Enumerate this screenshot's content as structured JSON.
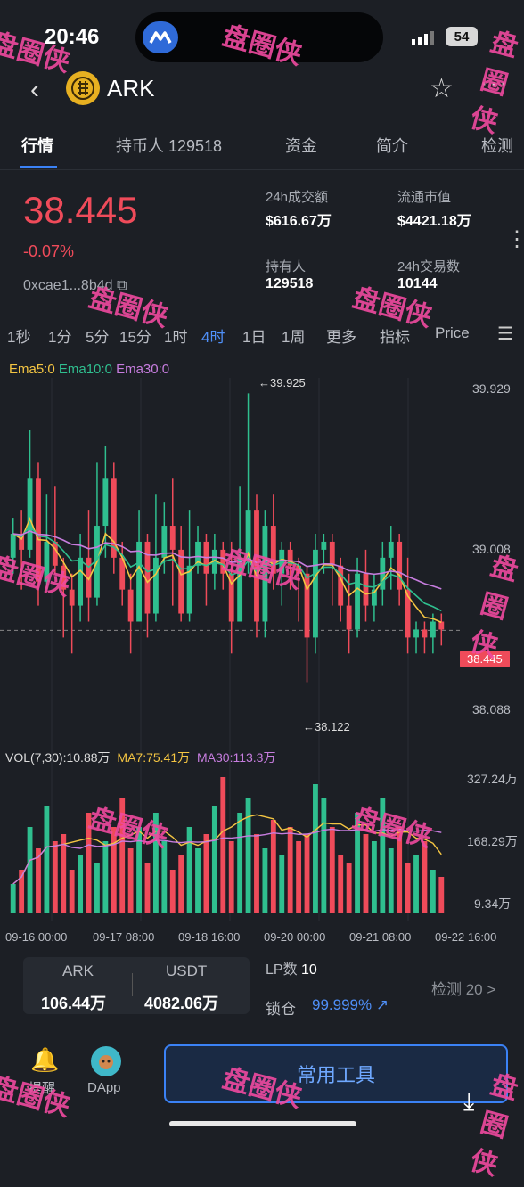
{
  "status_bar": {
    "time": "20:46",
    "battery": "54"
  },
  "header": {
    "back_icon": "back-icon",
    "coin_name": "ARK",
    "star_icon": "star-icon",
    "more_icon": "more-icon"
  },
  "tabs": [
    {
      "label": "行情",
      "active": true
    },
    {
      "label": "持币人 129518"
    },
    {
      "label": "资金"
    },
    {
      "label": "简介"
    },
    {
      "label": "检测"
    }
  ],
  "summary": {
    "price": "38.445",
    "change": "-0.07%",
    "address": "0xcae1...8b4d",
    "stats": [
      {
        "label": "24h成交额",
        "value": "$616.67万"
      },
      {
        "label": "流通市值",
        "value": "$4421.18万"
      },
      {
        "label": "持有人",
        "value": "129518"
      },
      {
        "label": "24h交易数",
        "value": "10144"
      }
    ]
  },
  "intervals": [
    "1秒",
    "1分",
    "5分",
    "15分",
    "1时",
    "4时",
    "1日",
    "1周",
    "更多",
    "指标",
    "Price"
  ],
  "active_interval": "4时",
  "indicators": {
    "ema5": "Ema5:0",
    "ema10": "Ema10:0",
    "ema30": "Ema30:0"
  },
  "chart_data": {
    "type": "candlestick",
    "price_axis": [
      "39.929",
      "39.008",
      "38.088"
    ],
    "current_price_tag": "38.445",
    "high_marker": "←39.925",
    "low_marker": "←38.122",
    "candles": [
      [
        38.9,
        39.05,
        39.15,
        38.8
      ],
      [
        39.05,
        38.95,
        39.2,
        38.7
      ],
      [
        38.95,
        39.4,
        39.7,
        38.9
      ],
      [
        39.4,
        38.75,
        39.5,
        38.6
      ],
      [
        38.75,
        39.0,
        39.3,
        38.7
      ],
      [
        39.0,
        38.85,
        39.35,
        38.8
      ],
      [
        38.85,
        38.7,
        38.9,
        38.4
      ],
      [
        38.7,
        38.6,
        38.8,
        38.3
      ],
      [
        38.6,
        38.9,
        39.05,
        38.5
      ],
      [
        38.9,
        38.65,
        39.2,
        38.5
      ],
      [
        38.65,
        39.1,
        39.5,
        38.6
      ],
      [
        39.1,
        39.4,
        39.6,
        38.9
      ],
      [
        39.4,
        38.9,
        39.5,
        38.8
      ],
      [
        38.9,
        38.7,
        39.0,
        38.6
      ],
      [
        38.7,
        38.5,
        38.8,
        38.3
      ],
      [
        38.5,
        39.0,
        39.2,
        38.5
      ],
      [
        39.0,
        38.55,
        39.05,
        38.4
      ],
      [
        38.55,
        38.9,
        39.3,
        38.5
      ],
      [
        38.9,
        39.1,
        39.25,
        38.8
      ],
      [
        39.1,
        38.95,
        39.4,
        38.6
      ],
      [
        38.95,
        38.55,
        39.1,
        38.5
      ],
      [
        38.55,
        38.85,
        39.2,
        38.5
      ],
      [
        38.85,
        39.0,
        39.1,
        38.8
      ],
      [
        39.0,
        38.8,
        39.05,
        38.6
      ],
      [
        38.8,
        38.95,
        39.05,
        38.7
      ],
      [
        38.95,
        38.8,
        39.0,
        38.7
      ],
      [
        38.8,
        38.5,
        39.0,
        38.3
      ],
      [
        38.5,
        38.9,
        39.35,
        38.5
      ],
      [
        38.9,
        39.2,
        39.93,
        38.8
      ],
      [
        39.2,
        38.5,
        39.3,
        38.4
      ],
      [
        38.5,
        39.1,
        39.2,
        38.4
      ],
      [
        39.1,
        38.8,
        39.3,
        38.7
      ],
      [
        38.8,
        38.95,
        39.0,
        38.6
      ],
      [
        38.95,
        38.85,
        39.0,
        38.7
      ],
      [
        38.85,
        38.8,
        38.9,
        38.5
      ],
      [
        38.8,
        38.4,
        38.85,
        38.12
      ],
      [
        38.4,
        38.95,
        39.05,
        38.3
      ],
      [
        38.95,
        39.0,
        39.05,
        38.8
      ],
      [
        39.0,
        38.85,
        39.05,
        38.6
      ],
      [
        38.85,
        38.6,
        38.9,
        38.5
      ],
      [
        38.6,
        38.45,
        38.8,
        38.3
      ],
      [
        38.45,
        38.8,
        38.9,
        38.4
      ],
      [
        38.8,
        38.6,
        38.95,
        38.5
      ],
      [
        38.6,
        38.7,
        38.8,
        38.5
      ],
      [
        38.7,
        38.9,
        39.0,
        38.6
      ],
      [
        38.9,
        39.0,
        39.1,
        38.7
      ],
      [
        39.0,
        38.7,
        39.05,
        38.6
      ],
      [
        38.7,
        38.4,
        38.9,
        38.3
      ],
      [
        38.4,
        38.45,
        38.5,
        38.3
      ],
      [
        38.45,
        38.4,
        38.5,
        38.3
      ],
      [
        38.4,
        38.5,
        38.55,
        38.3
      ],
      [
        38.5,
        38.45,
        38.55,
        38.35
      ]
    ],
    "volume_axis": [
      "327.24万",
      "168.29万",
      "9.34万"
    ],
    "volume_legend": {
      "vol": "VOL(7,30):10.88万",
      "ma7": "MA7:75.41万",
      "ma30": "MA30:113.3万"
    },
    "volumes": [
      40,
      60,
      120,
      90,
      150,
      100,
      110,
      60,
      80,
      140,
      70,
      100,
      120,
      160,
      90,
      120,
      70,
      140,
      100,
      60,
      80,
      120,
      90,
      110,
      150,
      190,
      100,
      140,
      160,
      110,
      90,
      130,
      80,
      120,
      100,
      110,
      180,
      160,
      120,
      80,
      70,
      140,
      110,
      100,
      160,
      90,
      120,
      70,
      80,
      100,
      60,
      50
    ],
    "x_labels": [
      "09-16 00:00",
      "09-17 08:00",
      "09-18 16:00",
      "09-20 00:00",
      "09-21 08:00",
      "09-22 16:00"
    ]
  },
  "liquidity": {
    "token_a": "ARK",
    "token_a_value": "106.44万",
    "token_b": "USDT",
    "token_b_value": "4082.06万",
    "lp_label": "LP数",
    "lp_value": "10",
    "lock_label": "锁仓",
    "lock_value": "99.999%",
    "detect": "检测 20 >"
  },
  "bottom_nav": {
    "alert_label": "提醒",
    "dapp_label": "DApp",
    "tools_label": "常用工具"
  },
  "watermark": "盘圈侠",
  "colors": {
    "up": "#2fbf8f",
    "down": "#ef4b5a",
    "accent": "#3b82f6",
    "ema5": "#f4c542",
    "ema10": "#2fbf8f",
    "ema30": "#c77ddf"
  }
}
